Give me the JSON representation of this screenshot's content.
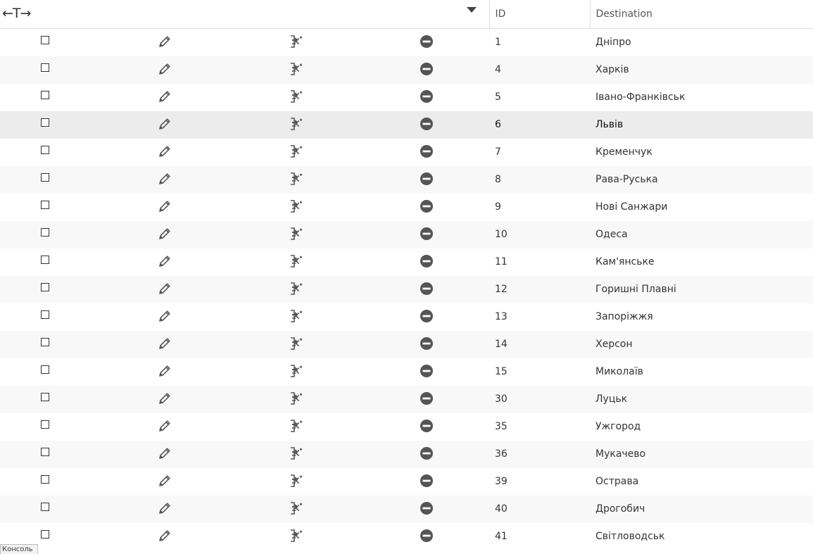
{
  "header": {
    "resize_glyph": "←T→",
    "id_label": "ID",
    "destination_label": "Destination"
  },
  "icons": {
    "edit": "pencil-icon",
    "copy": "copy-entity-icon",
    "delete": "minus-circle-icon",
    "menu": "caret-down-icon"
  },
  "colors": {
    "icon": "#555555",
    "row_stripe": "#f8f8f8",
    "row_selected": "#ececec"
  },
  "selected_id": "6",
  "rows": [
    {
      "id": "1",
      "destination": "Дніпро"
    },
    {
      "id": "4",
      "destination": "Харків"
    },
    {
      "id": "5",
      "destination": "Івано-Франківськ"
    },
    {
      "id": "6",
      "destination": "Львів"
    },
    {
      "id": "7",
      "destination": "Кременчук"
    },
    {
      "id": "8",
      "destination": "Рава-Руська"
    },
    {
      "id": "9",
      "destination": "Нові Санжари"
    },
    {
      "id": "10",
      "destination": "Одеса"
    },
    {
      "id": "11",
      "destination": "Кам'янське"
    },
    {
      "id": "12",
      "destination": "Горишні Плавні"
    },
    {
      "id": "13",
      "destination": "Запоріжжя"
    },
    {
      "id": "14",
      "destination": "Херсон"
    },
    {
      "id": "15",
      "destination": "Миколаїв"
    },
    {
      "id": "30",
      "destination": "Луцьк"
    },
    {
      "id": "35",
      "destination": "Ужгород"
    },
    {
      "id": "36",
      "destination": "Мукачево"
    },
    {
      "id": "39",
      "destination": "Острава"
    },
    {
      "id": "40",
      "destination": "Дрогобич"
    },
    {
      "id": "41",
      "destination": "Світловодськ"
    }
  ],
  "console_tab": "Консоль"
}
